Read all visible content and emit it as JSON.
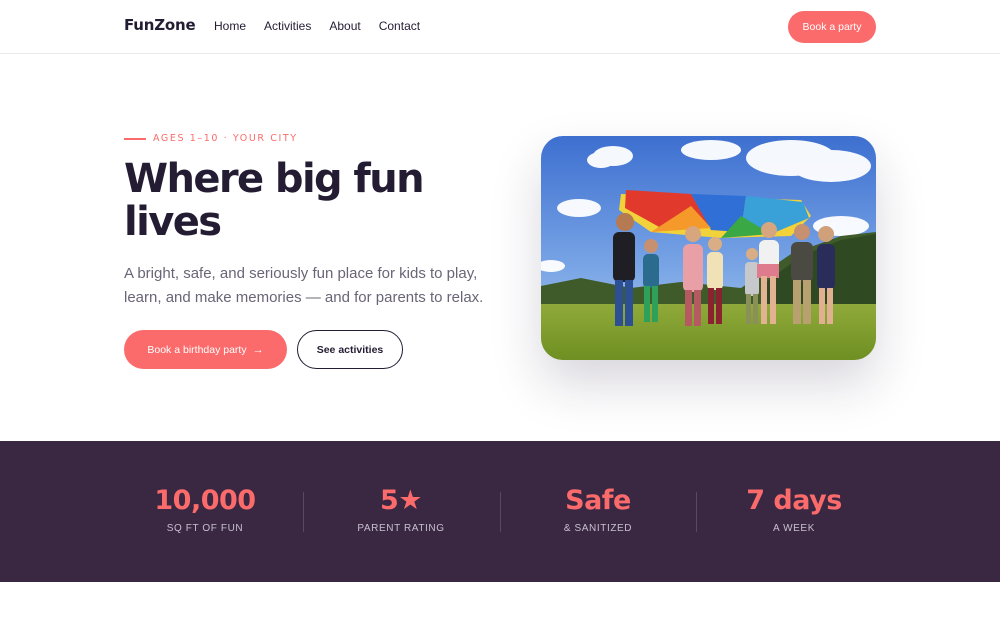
{
  "header": {
    "logo": "FunZone",
    "nav": [
      "Home",
      "Activities",
      "About",
      "Contact"
    ],
    "cta": "Book a party"
  },
  "hero": {
    "eyebrow": "AGES 1–10 · YOUR CITY",
    "title": "Where big fun lives",
    "description": "A bright, safe, and seriously fun place for kids to play, learn, and make memories — and for parents to relax.",
    "primary_button": "Book a birthday party",
    "primary_button_icon": "→",
    "secondary_button": "See activities",
    "image_description": ""
  },
  "stats": [
    {
      "value": "10,000",
      "label": "SQ FT OF FUN"
    },
    {
      "value": "5★",
      "label": "PARENT RATING"
    },
    {
      "value": "Safe",
      "label": "& SANITIZED"
    },
    {
      "value": "7 days",
      "label": "A WEEK"
    }
  ],
  "colors": {
    "accent": "#fb6b6b",
    "dark": "#241c33",
    "stats_bg": "#3a2742"
  }
}
